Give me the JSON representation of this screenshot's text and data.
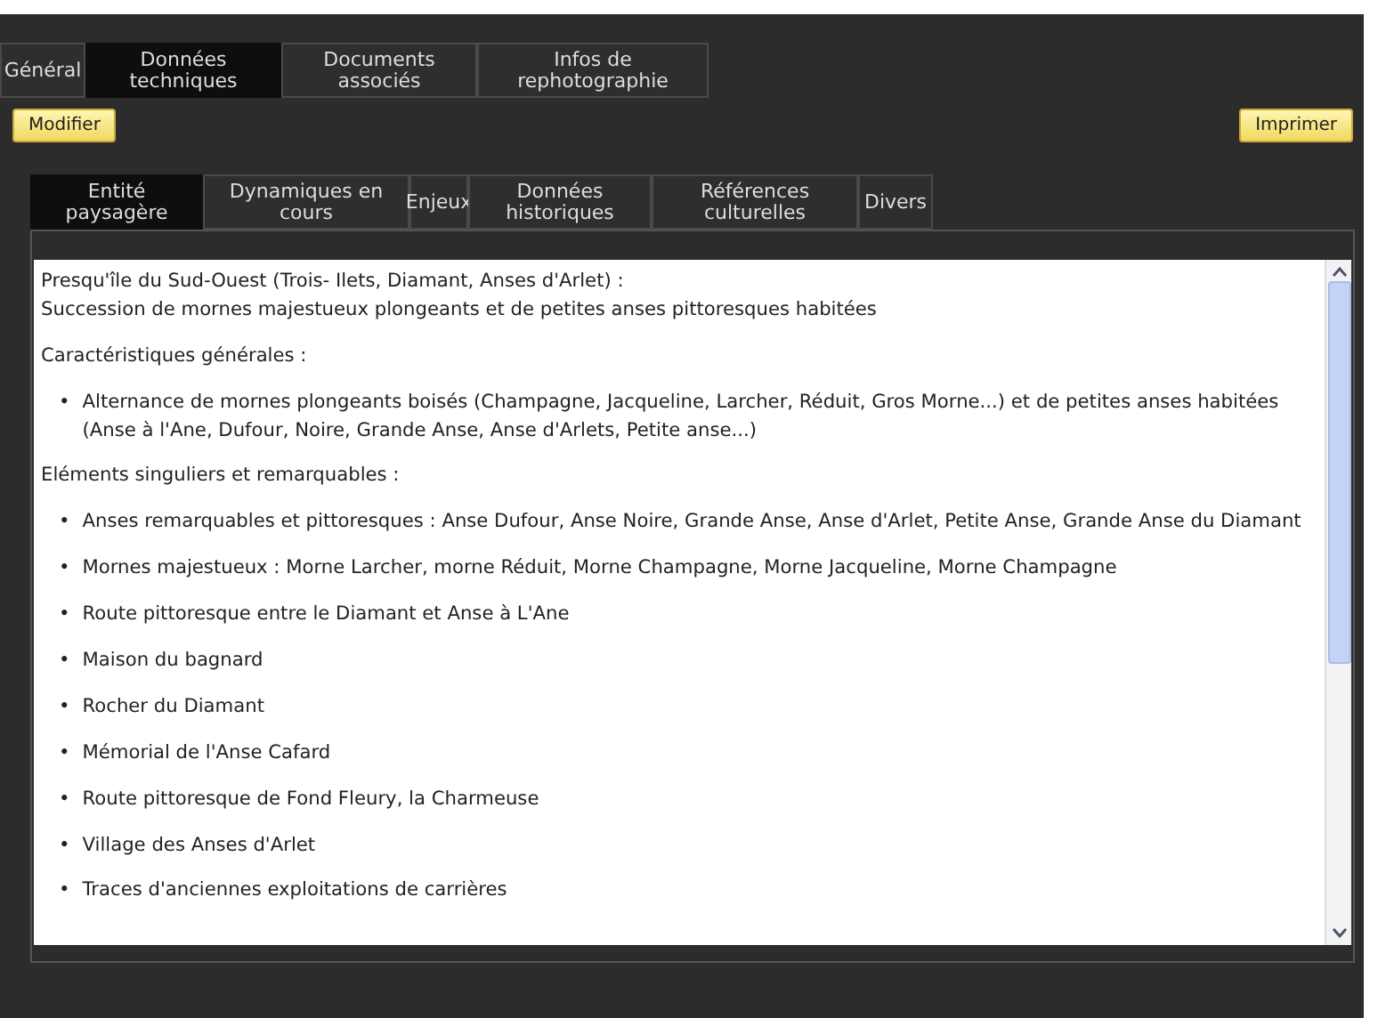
{
  "main_tabs": [
    {
      "label": "Général",
      "selected": false
    },
    {
      "label": "Données techniques",
      "selected": true
    },
    {
      "label": "Documents associés",
      "selected": false
    },
    {
      "label": "Infos de rephotographie",
      "selected": false
    }
  ],
  "buttons": {
    "left": "Modifier",
    "right": "Imprimer"
  },
  "sub_tabs": [
    {
      "label": "Entité paysagère",
      "selected": true
    },
    {
      "label": "Dynamiques en cours",
      "selected": false
    },
    {
      "label": "Enjeux",
      "selected": false
    },
    {
      "label": "Données historiques",
      "selected": false
    },
    {
      "label": "Références culturelles",
      "selected": false
    },
    {
      "label": "Divers",
      "selected": false
    }
  ],
  "content": [
    {
      "kind": "paragraph",
      "lines": [
        "Presqu'île du Sud-Ouest (Trois- Ilets, Diamant, Anses d'Arlet) :",
        "Succession de mornes majestueux plongeants et de petites anses pittoresques habitées"
      ]
    },
    {
      "kind": "paragraph",
      "lines": [
        "Caractéristiques générales :"
      ]
    },
    {
      "kind": "list",
      "marker": "•",
      "items": [
        "Alternance de mornes plongeants boisés (Champagne, Jacqueline, Larcher, Réduit, Gros Morne...) et de petites anses habitées (Anse à l'Ane, Dufour, Noire, Grande Anse, Anse d'Arlets, Petite anse...)"
      ]
    },
    {
      "kind": "paragraph",
      "lines": [
        "Eléments singuliers et remarquables :"
      ]
    },
    {
      "kind": "list",
      "marker": "•",
      "items": [
        "Anses remarquables et pittoresques : Anse Dufour, Anse Noire, Grande Anse, Anse d'Arlet, Petite Anse, Grande Anse du Diamant",
        "Mornes majestueux : Morne Larcher, morne Réduit, Morne Champagne, Morne Jacqueline, Morne Champagne",
        "Route pittoresque entre le Diamant et Anse à L'Ane",
        "Maison du bagnard",
        "Rocher du Diamant",
        "Mémorial de l'Anse Cafard",
        "Route pittoresque de Fond Fleury, la Charmeuse",
        "Village des Anses d'Arlet",
        "Traces d'anciennes exploitations de carrières"
      ]
    }
  ]
}
